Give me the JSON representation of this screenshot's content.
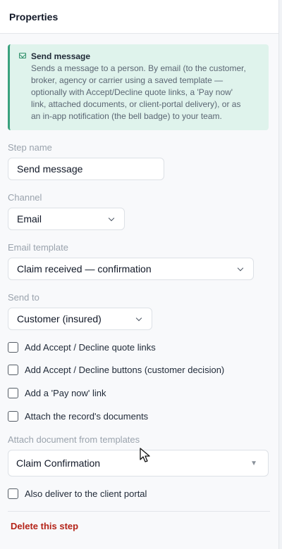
{
  "panel": {
    "title": "Properties"
  },
  "info": {
    "title": "Send message",
    "lines": [
      "Sends a message to a person. By email (to the customer,",
      "broker, agency or carrier using a saved template —",
      "optionally with Accept/Decline quote links, a 'Pay now'",
      "link, attached documents, or client-portal delivery), or as",
      "an in-app notification (the bell badge) to your team."
    ],
    "icon": "mail-icon"
  },
  "step_name": {
    "label": "Step name",
    "value": "Send message"
  },
  "channel": {
    "label": "Channel",
    "value": "Email"
  },
  "email_template": {
    "label": "Email template",
    "value": "Claim received — confirmation"
  },
  "send_to": {
    "label": "Send to",
    "value": "Customer (insured)"
  },
  "options": [
    {
      "label": "Add Accept / Decline quote links",
      "checked": false
    },
    {
      "label": "Add Accept / Decline buttons (customer decision)",
      "checked": false
    },
    {
      "label": "Add a 'Pay now' link",
      "checked": false
    },
    {
      "label": "Attach the record's documents",
      "checked": false
    }
  ],
  "attach_template": {
    "label": "Attach document from templates",
    "value": "Claim Confirmation"
  },
  "portal": {
    "label": "Also deliver to the client portal",
    "checked": false
  },
  "delete_label": "Delete this step",
  "colors": {
    "accent_green": "#3aa17e",
    "info_bg": "#dff3ec",
    "danger": "#b42318"
  }
}
